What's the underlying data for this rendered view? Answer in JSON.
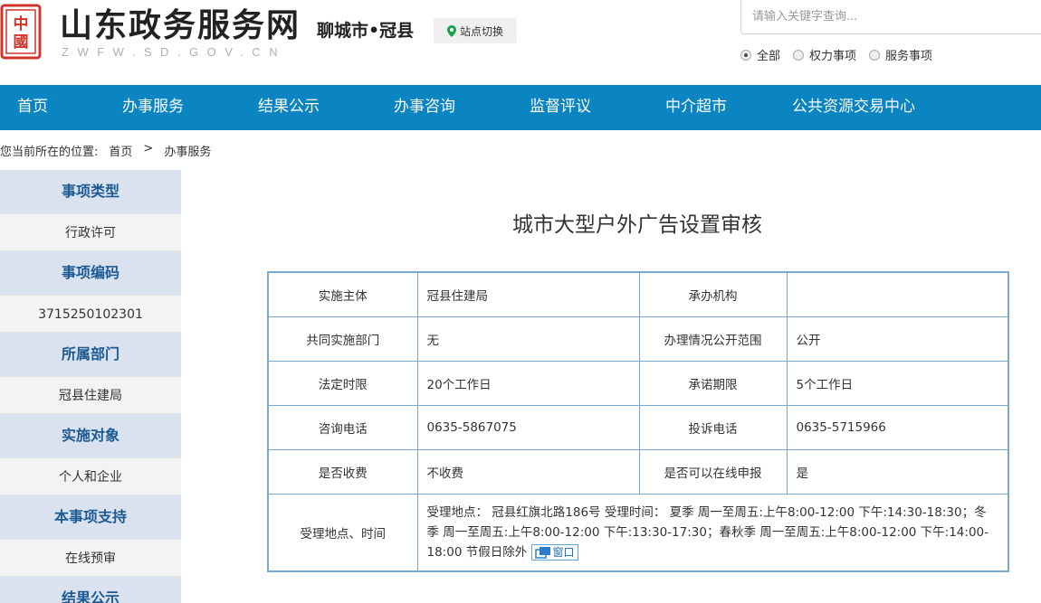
{
  "header": {
    "seal_text": "中國",
    "site_title": "山东政务服务网",
    "site_domain": "ZWFW.SD.GOV.CN",
    "city": "聊城市•冠县",
    "switch_label": "站点切换",
    "search_placeholder": "请输入关键字查询...",
    "radio_options": [
      {
        "label": "全部",
        "checked": true
      },
      {
        "label": "权力事项",
        "checked": false
      },
      {
        "label": "服务事项",
        "checked": false
      }
    ]
  },
  "nav": {
    "items": [
      "首页",
      "办事服务",
      "结果公示",
      "办事咨询",
      "监督评议",
      "中介超市",
      "公共资源交易中心"
    ]
  },
  "breadcrumb": {
    "prefix": "您当前所在的位置:",
    "home": "首页",
    "separator": ">",
    "current": "办事服务"
  },
  "sidebar": {
    "sections": [
      {
        "heading": "事项类型",
        "value": "行政许可"
      },
      {
        "heading": "事项编码",
        "value": "3715250102301"
      },
      {
        "heading": "所属部门",
        "value": "冠县住建局"
      },
      {
        "heading": "实施对象",
        "value": "个人和企业"
      },
      {
        "heading": "本事项支持",
        "value": "在线预审"
      },
      {
        "heading": "结果公示",
        "value": ""
      }
    ]
  },
  "main": {
    "title": "城市大型户外广告设置审核",
    "rows": [
      {
        "l1": "实施主体",
        "v1": "冠县住建局",
        "l2": "承办机构",
        "v2": ""
      },
      {
        "l1": "共同实施部门",
        "v1": "无",
        "l2": "办理情况公开范围",
        "v2": "公开"
      },
      {
        "l1": "法定时限",
        "v1": "20个工作日",
        "l2": "承诺期限",
        "v2": "5个工作日"
      },
      {
        "l1": "咨询电话",
        "v1": "0635-5867075",
        "l2": "投诉电话",
        "v2": "0635-5715966"
      },
      {
        "l1": "是否收费",
        "v1": "不收费",
        "l2": "是否可以在线申报",
        "v2": "是"
      }
    ],
    "location_label": "受理地点、时间",
    "location_text": "受理地点： 冠县红旗北路186号 受理时间： 夏季 周一至周五:上午8:00-12:00 下午:14:30-18:30；冬季 周一至周五:上午8:00-12:00 下午:13:30-17:30；春秋季 周一至周五:上午8:00-12:00 下午:14:00-18:00 节假日除外",
    "window_button": "窗口"
  },
  "colors": {
    "nav_bg": "#0a85c2",
    "sidebar_head_bg": "#d9e2ee",
    "sidebar_head_text": "#1c5a94",
    "table_border": "#7aa8cf",
    "seal_red": "#d0342c"
  }
}
